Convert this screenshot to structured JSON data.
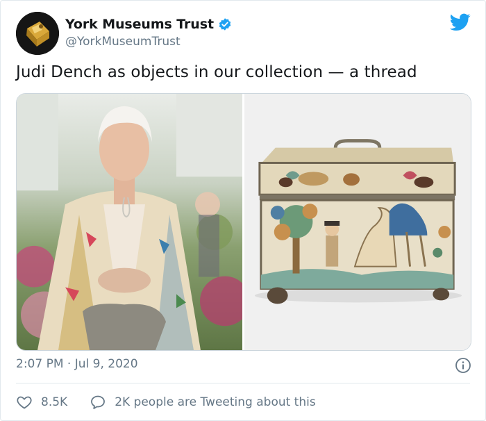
{
  "tweet": {
    "author": {
      "display_name": "York Museums Trust",
      "handle": "@YorkMuseumTrust",
      "verified": true,
      "avatar_icon": "lantern-object-avatar"
    },
    "text": "Judi Dench as objects in our collection — a thread",
    "media": [
      {
        "alt_icon": "photo-woman-embroidered-jacket"
      },
      {
        "alt_icon": "photo-embroidered-casket"
      }
    ],
    "timestamp": "2:07 PM · Jul 9, 2020",
    "likes": "8.5K",
    "conversation": "2K people are Tweeting about this"
  },
  "icons": {
    "brand": "twitter-bird-icon",
    "verified": "verified-badge-icon",
    "info": "info-icon",
    "like": "heart-icon",
    "reply": "speech-bubble-icon"
  },
  "colors": {
    "brand_blue": "#1da1f2",
    "text_primary": "#14171a",
    "text_secondary": "#657786",
    "border": "#e1e8ed"
  }
}
